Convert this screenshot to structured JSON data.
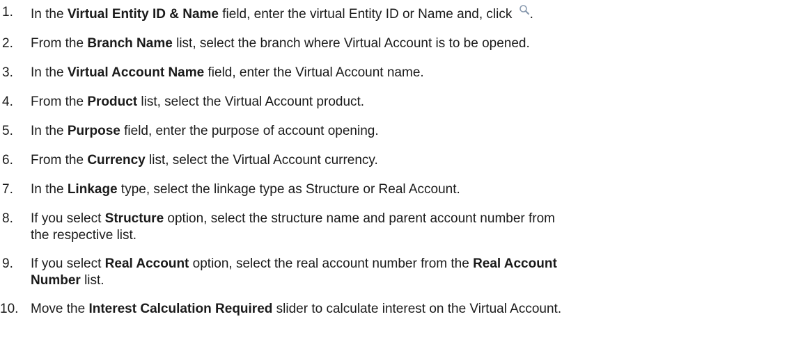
{
  "steps": [
    {
      "num": "1.",
      "pre": "In the ",
      "bold": "Virtual Entity ID & Name",
      "post": " field, enter the virtual Entity ID or Name and, click ",
      "icon": "search-icon",
      "end": "."
    },
    {
      "num": "2.",
      "pre": "From the ",
      "bold": "Branch Name",
      "post": " list, select the branch where Virtual Account is to be opened."
    },
    {
      "num": "3.",
      "pre": "In the ",
      "bold": "Virtual Account Name",
      "post": " field, enter the Virtual Account name."
    },
    {
      "num": "4.",
      "pre": "From the ",
      "bold": "Product",
      "post": " list, select the Virtual Account product."
    },
    {
      "num": "5.",
      "pre": "In the ",
      "bold": "Purpose",
      "post": " field, enter the purpose of account opening."
    },
    {
      "num": "6.",
      "pre": "From the ",
      "bold": "Currency",
      "post": " list, select the Virtual Account currency."
    },
    {
      "num": "7.",
      "pre": "In the ",
      "bold": "Linkage",
      "post": " type, select the linkage type as Structure or Real Account."
    },
    {
      "num": "8.",
      "pre": "If you select ",
      "bold": "Structure",
      "post": " option, select the structure name and parent account number from",
      "line2": "the respective list."
    },
    {
      "num": "9.",
      "pre": "If you select ",
      "bold": "Real Account",
      "post": " option, select the real account number from the ",
      "bold2": "Real Account",
      "line2_bold": "Number",
      "line2_post": " list."
    },
    {
      "num": "10.",
      "pre": "Move the ",
      "bold": "Interest Calculation Required",
      "post": " slider to calculate interest on the Virtual Account."
    }
  ]
}
